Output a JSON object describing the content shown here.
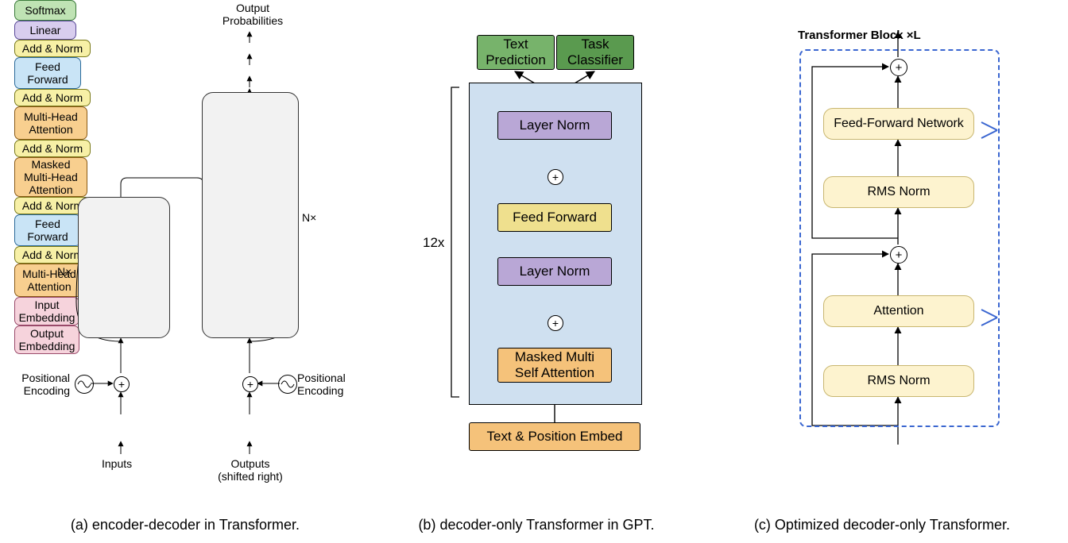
{
  "captions": {
    "a": "(a) encoder-decoder in Transformer.",
    "b": "(b) decoder-only Transformer in GPT.",
    "c": "(c) Optimized decoder-only Transformer."
  },
  "a": {
    "output_prob": "Output\nProbabilities",
    "softmax": "Softmax",
    "linear": "Linear",
    "addnorm": "Add & Norm",
    "ff": "Feed\nForward",
    "mha": "Multi-Head\nAttention",
    "masked_mha": "Masked\nMulti-Head\nAttention",
    "input_embed": "Input\nEmbedding",
    "output_embed": "Output\nEmbedding",
    "inputs": "Inputs",
    "outputs": "Outputs\n(shifted right)",
    "pos_enc": "Positional\nEncoding",
    "nx": "N×"
  },
  "b": {
    "repeat": "12x",
    "embed": "Text & Position Embed",
    "masked": "Masked Multi\nSelf Attention",
    "ln": "Layer Norm",
    "ff": "Feed Forward",
    "text_pred": "Text\nPrediction",
    "task_cls": "Task\nClassifier"
  },
  "c": {
    "title": "Transformer Block ×L",
    "rmsnorm": "RMS Norm",
    "attn": "Attention",
    "ffn": "Feed-Forward Network"
  }
}
